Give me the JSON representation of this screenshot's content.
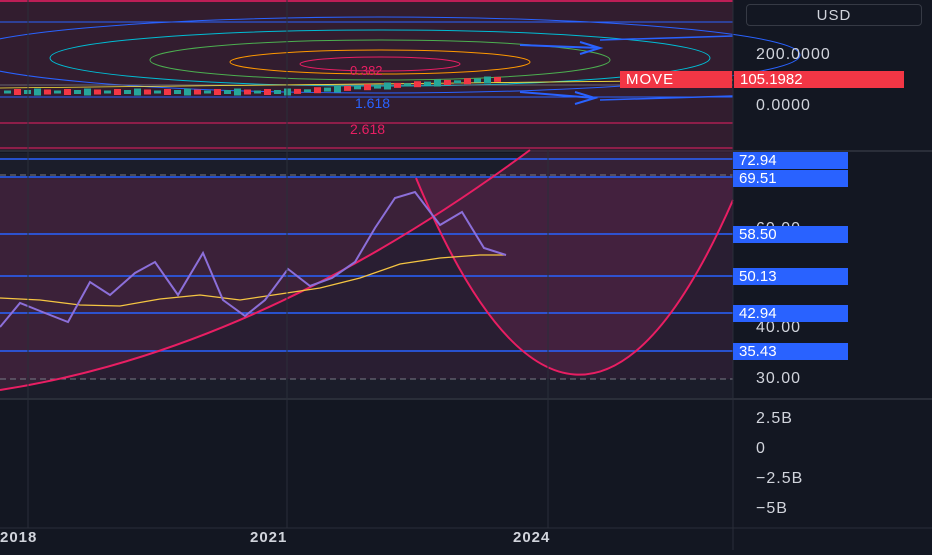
{
  "header": {
    "currency": "USD"
  },
  "top_pane": {
    "axis_labels": [
      "200.0000",
      "0.0000"
    ],
    "symbol_label": "MOVE",
    "last_price": "105.1982",
    "fib_labels": [
      "1.618",
      "2.618",
      "0.382"
    ]
  },
  "rsi_pane": {
    "axis_labels": [
      "60.00",
      "40.00",
      "30.00"
    ],
    "level_tags": [
      "72.94",
      "69.51",
      "58.50",
      "50.13",
      "42.94",
      "35.43"
    ]
  },
  "volume_pane": {
    "axis_labels": [
      "2.5B",
      "0",
      "−2.5B",
      "−5B"
    ]
  },
  "time_axis": [
    "2018",
    "2021",
    "2024"
  ],
  "colors": {
    "background": "#131722",
    "level_line": "#2962ff",
    "rsi_line": "#8c6fd9",
    "rsi_ma": "#f5c542",
    "parabola": "#e91e63",
    "candle_up": "#26a69a",
    "candle_down": "#f23645"
  }
}
